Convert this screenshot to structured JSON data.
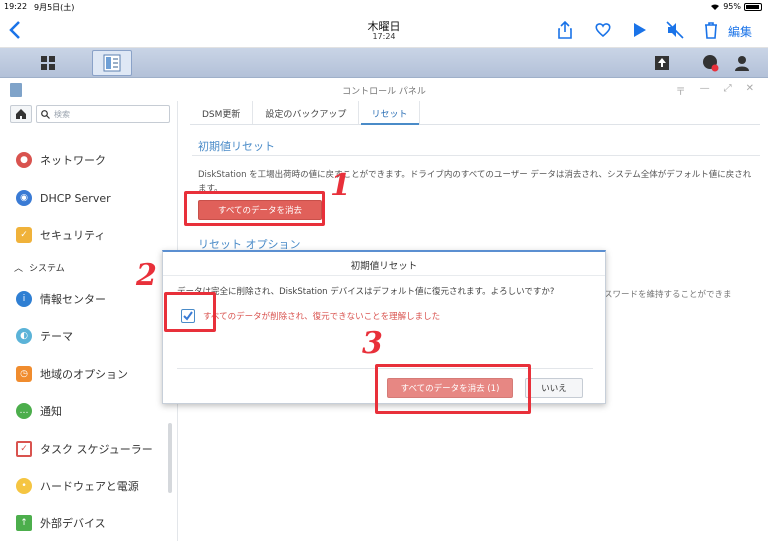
{
  "status_bar": {
    "time": "19:22",
    "date": "9月5日(土)",
    "battery": "95%"
  },
  "photo_viewer": {
    "title": "木曜日",
    "subtitle": "17:24",
    "edit_label": "編集"
  },
  "window": {
    "title": "コントロール パネル"
  },
  "sidebar": {
    "search_placeholder": "検索",
    "items": [
      {
        "label": "ネットワーク",
        "icon": "network-icon",
        "color": "#d9534f"
      },
      {
        "label": "DHCP Server",
        "icon": "dhcp-icon",
        "color": "#3a7bd5"
      },
      {
        "label": "セキュリティ",
        "icon": "shield-icon",
        "color": "#f0b23a"
      },
      {
        "label": "情報センター",
        "icon": "info-icon",
        "color": "#2f7fd3"
      },
      {
        "label": "テーマ",
        "icon": "palette-icon",
        "color": "#5bb3d8"
      },
      {
        "label": "地域のオプション",
        "icon": "clock-icon",
        "color": "#f08c2e"
      },
      {
        "label": "通知",
        "icon": "chat-icon",
        "color": "#4cae4c"
      },
      {
        "label": "タスク スケジューラー",
        "icon": "calendar-icon",
        "color": "#d9534f"
      },
      {
        "label": "ハードウェアと電源",
        "icon": "bulb-icon",
        "color": "#f5c542"
      },
      {
        "label": "外部デバイス",
        "icon": "external-device-icon",
        "color": "#4cae4c"
      }
    ],
    "section_system": "システム"
  },
  "tabs": [
    {
      "label": "DSM更新"
    },
    {
      "label": "設定のバックアップ"
    },
    {
      "label": "リセット"
    }
  ],
  "main": {
    "section1_title": "初期値リセット",
    "description": "DiskStation を工場出荷時の値に戻すことができます。ドライブ内のすべてのユーザー データは消去され、システム全体がデフォルト値に戻されます。",
    "erase_button": "すべてのデータを消去",
    "section2_title": "リセット オプション",
    "bg_cut_text": "スワードを維持することができま"
  },
  "dialog": {
    "title": "初期値リセット",
    "message": "データは完全に削除され、DiskStation デバイスはデフォルト値に復元されます。よろしいですか?",
    "checkbox_label": "すべてのデータが削除され、復元できないことを理解しました",
    "checkbox_checked": true,
    "confirm_button": "すべてのデータを消去 (1)",
    "cancel_button": "いいえ"
  },
  "annotations": {
    "n1": "1",
    "n2": "2",
    "n3": "3",
    "color": "#e8303a"
  }
}
